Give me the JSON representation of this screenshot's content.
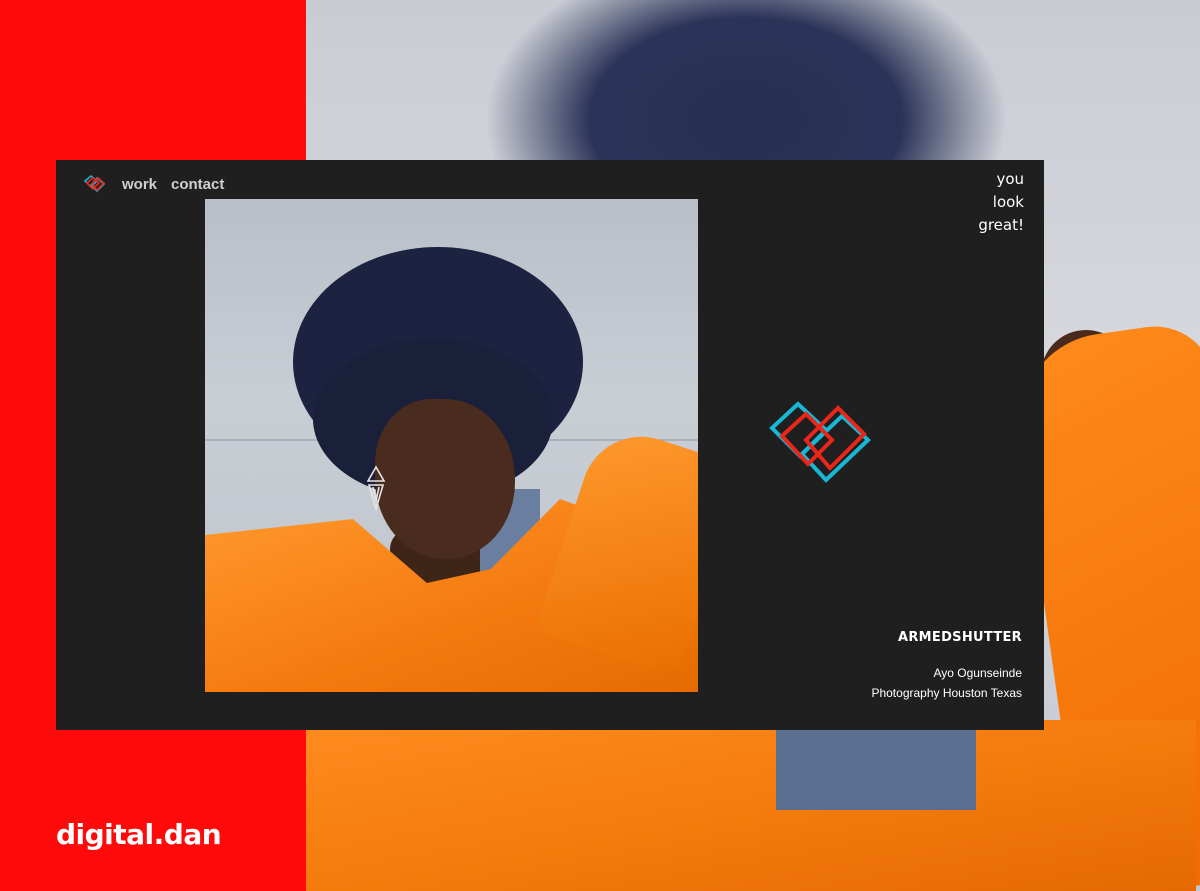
{
  "background": {
    "accent_red": "#ff0a0a",
    "window_bg": "#1f1f20",
    "heart_red": "#e8261a",
    "heart_cyan": "#1ab6d6"
  },
  "brand": {
    "text": "digital.dan"
  },
  "nav": {
    "logo_icon": "heart-logo-icon",
    "links": [
      {
        "label": "work"
      },
      {
        "label": "contact"
      }
    ]
  },
  "tagline": {
    "lines": [
      "you",
      "look",
      "great!"
    ]
  },
  "main": {
    "hero_logo_icon": "heart-logo-icon",
    "studio_name": "ARMEDSHUTTER",
    "subtitle": [
      "Ayo Ogunseinde",
      "Photography Houston Texas"
    ]
  }
}
